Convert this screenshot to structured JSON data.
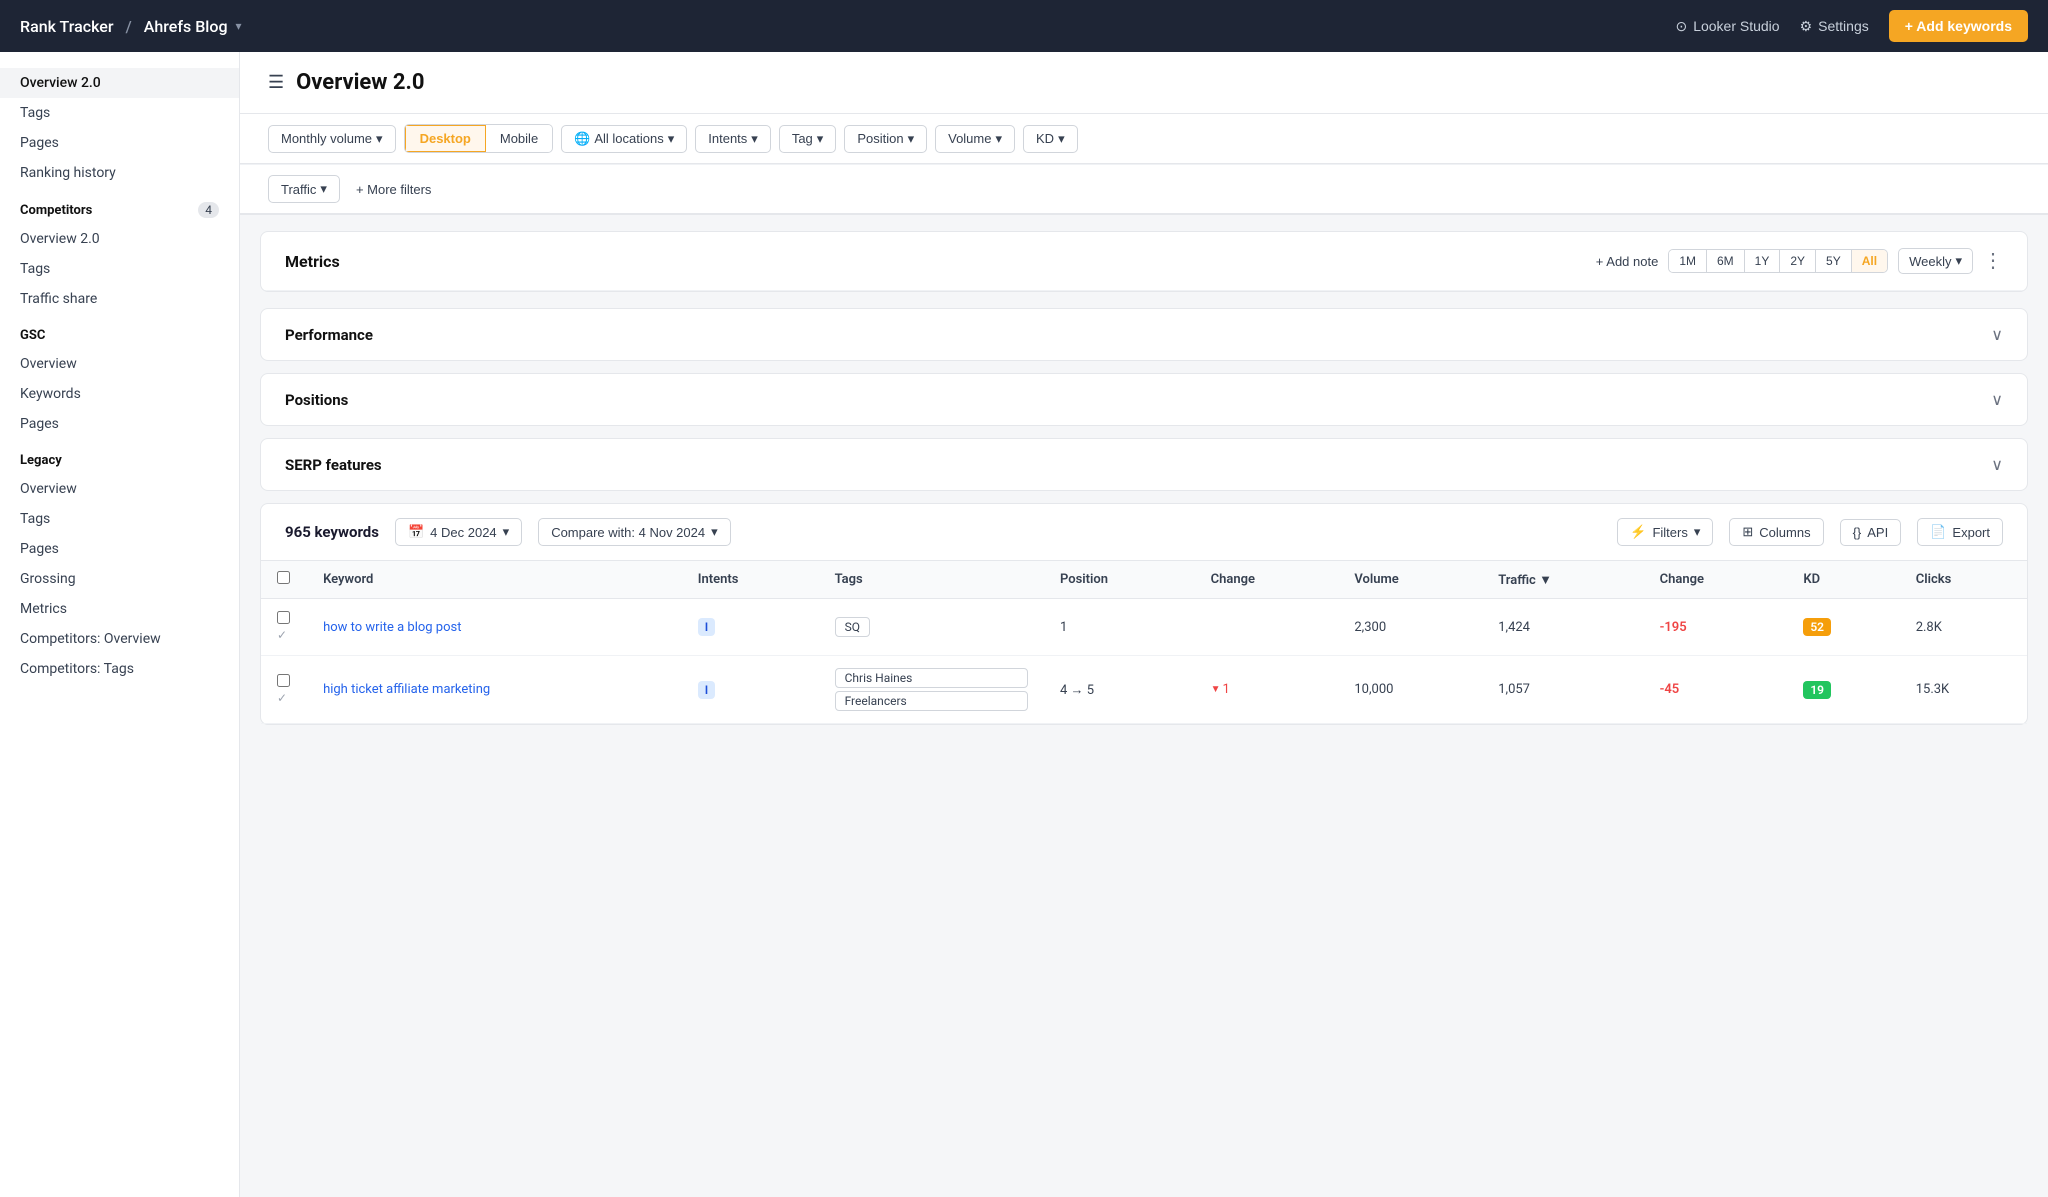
{
  "topNav": {
    "appName": "Rank Tracker",
    "separator": "/",
    "blogName": "Ahrefs Blog",
    "lookerStudio": "Looker Studio",
    "settings": "Settings",
    "addKeywords": "+ Add keywords"
  },
  "sidebar": {
    "items": [
      {
        "label": "Overview 2.0",
        "active": true,
        "level": "top"
      },
      {
        "label": "Tags",
        "active": false,
        "level": "top"
      },
      {
        "label": "Pages",
        "active": false,
        "level": "top"
      },
      {
        "label": "Ranking history",
        "active": false,
        "level": "top"
      }
    ],
    "sections": [
      {
        "title": "Competitors",
        "badge": "4",
        "items": [
          {
            "label": "Overview 2.0"
          },
          {
            "label": "Tags"
          },
          {
            "label": "Traffic share"
          }
        ]
      },
      {
        "title": "GSC",
        "badge": null,
        "items": [
          {
            "label": "Overview"
          },
          {
            "label": "Keywords"
          },
          {
            "label": "Pages"
          }
        ]
      },
      {
        "title": "Legacy",
        "badge": null,
        "items": [
          {
            "label": "Overview"
          },
          {
            "label": "Tags"
          },
          {
            "label": "Pages"
          },
          {
            "label": "Grossing"
          },
          {
            "label": "Metrics"
          },
          {
            "label": "Competitors: Overview"
          },
          {
            "label": "Competitors: Tags"
          }
        ]
      }
    ]
  },
  "pageTitle": "Overview 2.0",
  "filters": {
    "monthlyVolume": "Monthly volume",
    "desktop": "Desktop",
    "mobile": "Mobile",
    "allLocations": "All locations",
    "intents": "Intents",
    "tag": "Tag",
    "position": "Position",
    "volume": "Volume",
    "kd": "KD",
    "traffic": "Traffic",
    "moreFilters": "+ More filters"
  },
  "metrics": {
    "title": "Metrics",
    "addNote": "+ Add note",
    "timeRanges": [
      "1M",
      "6M",
      "1Y",
      "2Y",
      "5Y",
      "All"
    ],
    "activeTimeRange": "All",
    "frequency": "Weekly"
  },
  "collapsibles": [
    {
      "title": "Performance"
    },
    {
      "title": "Positions"
    },
    {
      "title": "SERP features"
    }
  ],
  "keywordsTable": {
    "count": "965 keywords",
    "date": "4 Dec 2024",
    "compareWith": "Compare with: 4 Nov 2024",
    "filters": "Filters",
    "columns": "Columns",
    "api": "API",
    "export": "Export",
    "headers": [
      "Keyword",
      "Intents",
      "Tags",
      "Position",
      "Change",
      "Volume",
      "Traffic",
      "Change",
      "KD",
      "Clicks"
    ],
    "rows": [
      {
        "keyword": "how to write a blog post",
        "intent": "I",
        "tags": [
          "SQ"
        ],
        "position": "1",
        "change": "",
        "volume": "2,300",
        "traffic": "1,424",
        "trafficChange": "-195",
        "kd": "52",
        "kdColor": "orange",
        "clicks": "2.8K",
        "checked": true
      },
      {
        "keyword": "high ticket affiliate marketing",
        "intent": "I",
        "tags": [
          "Chris Haines",
          "Freelancers"
        ],
        "position": "4 → 5",
        "change": "▼1",
        "volume": "10,000",
        "traffic": "1,057",
        "trafficChange": "-45",
        "kd": "19",
        "kdColor": "green",
        "clicks": "15.3K",
        "checked": false
      }
    ]
  }
}
